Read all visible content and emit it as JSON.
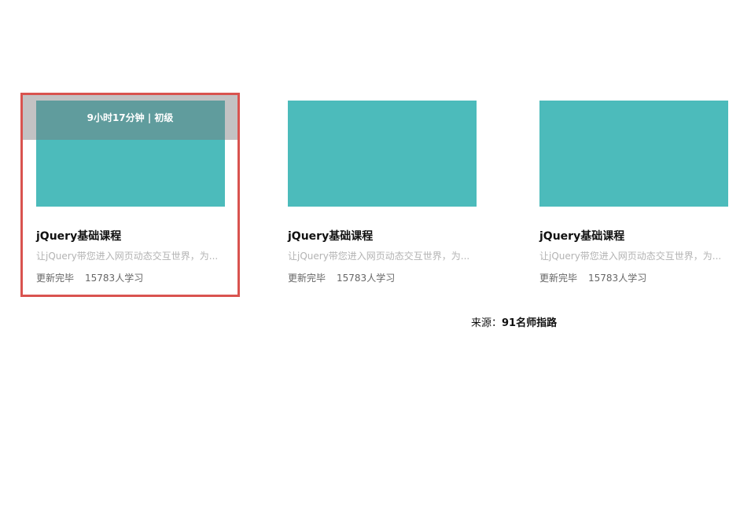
{
  "courses": [
    {
      "title": "jQuery基础课程",
      "description": "让jQuery带您进入网页动态交互世界，为...",
      "status": "更新完毕",
      "learners": "15783人学习",
      "overlay": "9小时17分钟 | 初级",
      "selected": true
    },
    {
      "title": "jQuery基础课程",
      "description": "让jQuery带您进入网页动态交互世界，为...",
      "status": "更新完毕",
      "learners": "15783人学习",
      "selected": false
    },
    {
      "title": "jQuery基础课程",
      "description": "让jQuery带您进入网页动态交互世界，为...",
      "status": "更新完毕",
      "learners": "15783人学习",
      "selected": false
    }
  ],
  "source": {
    "label": "来源：",
    "name": "91名师指路"
  },
  "colors": {
    "thumbnail": "#4cbbbb",
    "selected_border": "#d9534f",
    "overlay": "#7b7879"
  }
}
